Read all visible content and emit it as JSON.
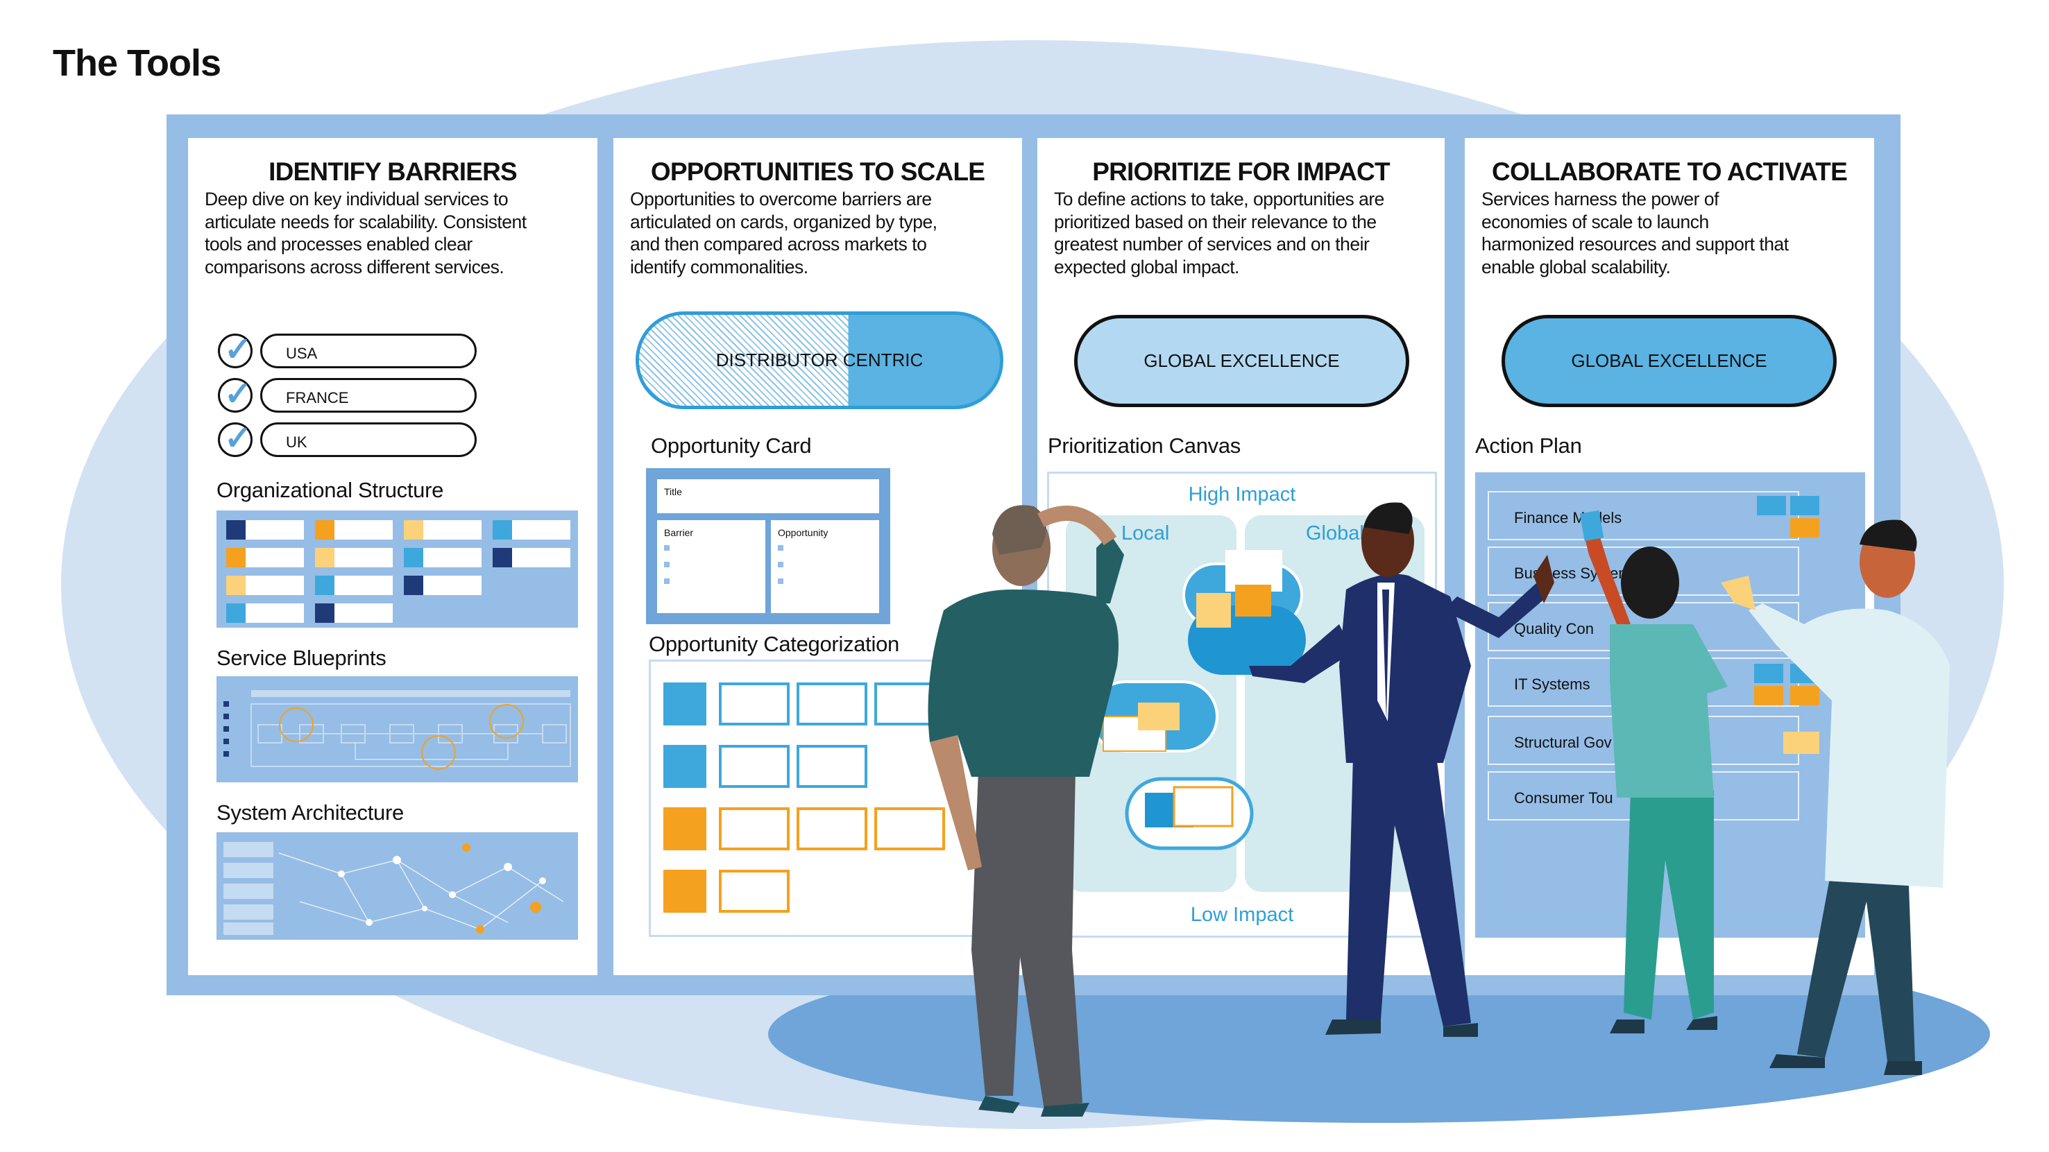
{
  "title": "The Tools",
  "panels": [
    {
      "heading": "IDENTIFY BARRIERS",
      "body": [
        "Deep dive on key individual services to",
        "articulate needs for scalability. Consistent",
        "tools and processes enabled clear",
        "comparisons across different services."
      ],
      "checklist": [
        "USA",
        "FRANCE",
        "UK"
      ],
      "sections": [
        "Organizational Structure",
        "Service Blueprints",
        "System Architecture"
      ]
    },
    {
      "heading": "OPPORTUNITIES TO SCALE",
      "body": [
        "Opportunities to overcome barriers are",
        "articulated on cards, organized by type,",
        "and then compared across markets to",
        "identify commonalities."
      ],
      "pill": "DISTRIBUTOR CENTRIC",
      "sections": [
        "Opportunity Card",
        "Opportunity Categorization"
      ],
      "card": {
        "title": "Title",
        "left": "Barrier",
        "right": "Opportunity"
      }
    },
    {
      "heading": "PRIORITIZE FOR IMPACT",
      "body": [
        "To define actions to take, opportunities are",
        "prioritized based on their relevance to the",
        "greatest number of services and on their",
        "expected global impact."
      ],
      "pill": "GLOBAL EXCELLENCE",
      "sections": [
        "Prioritization Canvas"
      ],
      "canvas": {
        "top": "High Impact",
        "bottom": "Low Impact",
        "left": "Local",
        "right": "Global"
      }
    },
    {
      "heading": "COLLABORATE TO ACTIVATE",
      "body": [
        "Services harness the power of",
        "economies of scale to launch",
        "harmonized resources and support that",
        "enable global scalability."
      ],
      "pill": "GLOBAL EXCELLENCE",
      "sections": [
        "Action Plan"
      ],
      "action_rows": [
        "Finance Models",
        "Business Systems",
        "Quality Con",
        "IT Systems",
        "Structural Gov",
        "Consumer Tou"
      ]
    }
  ],
  "colors": {
    "frame": "#95bde6",
    "background": "#d2e2f3",
    "floor": "#6fa5d8",
    "accent_blue": "#3ea8dc",
    "accent_orange": "#f4a11f",
    "accent_yellow": "#fbd27a"
  }
}
